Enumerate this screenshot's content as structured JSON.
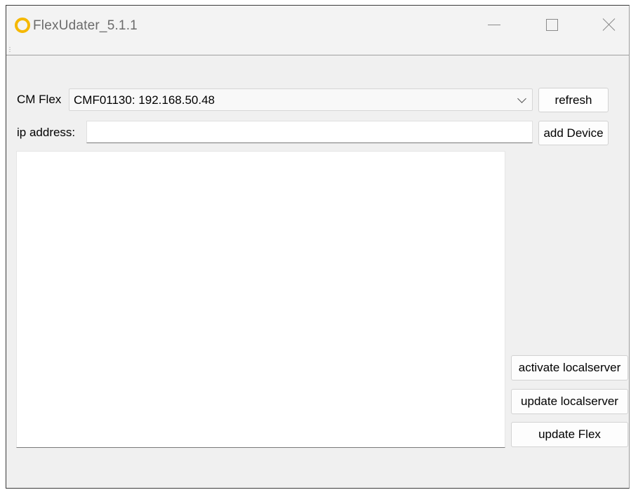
{
  "window": {
    "title": "FlexUdater_5.1.1",
    "icon": "ring-icon",
    "accent_color": "#f5b800"
  },
  "form": {
    "device_label": "CM Flex",
    "device_selected": "CMF01130: 192.168.50.48",
    "ip_label": "ip address:",
    "ip_value": "",
    "ip_placeholder": ""
  },
  "buttons": {
    "refresh": "refresh",
    "add_device": "add Device",
    "activate_localserver": "activate localserver",
    "update_localserver": "update localserver",
    "update_flex": "update Flex"
  },
  "log": {
    "content": ""
  }
}
